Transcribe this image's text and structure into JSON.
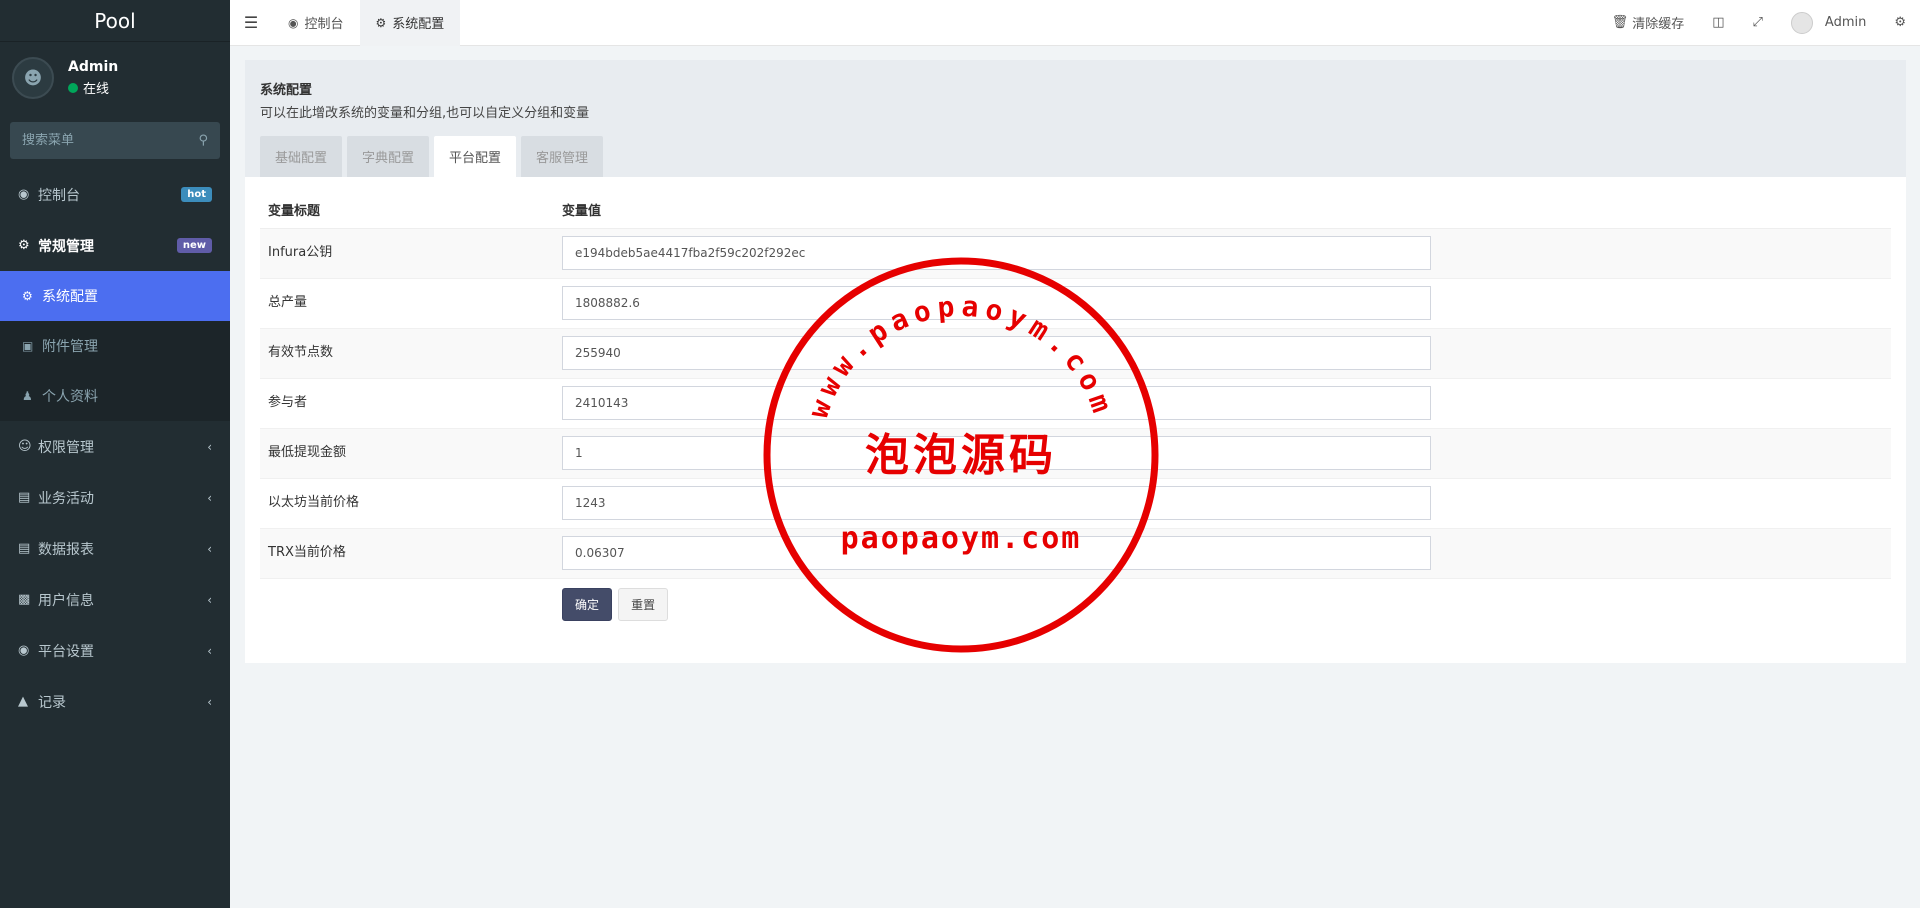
{
  "sidebar": {
    "logo": "Pool",
    "user": {
      "name": "Admin",
      "status": "在线"
    },
    "search_placeholder": "搜索菜单",
    "menu": [
      {
        "label": "控制台",
        "icon": "dashboard-icon",
        "badge": "hot"
      },
      {
        "label": "常规管理",
        "icon": "cogs-icon",
        "badge": "new"
      }
    ],
    "submenu": [
      {
        "label": "系统配置",
        "icon": "gear-icon",
        "active": true
      },
      {
        "label": "附件管理",
        "icon": "file-image-icon"
      },
      {
        "label": "个人资料",
        "icon": "user-icon"
      }
    ],
    "more_menu": [
      {
        "label": "权限管理",
        "icon": "group-icon"
      },
      {
        "label": "业务活动",
        "icon": "money-icon"
      },
      {
        "label": "数据报表",
        "icon": "file-text-icon"
      },
      {
        "label": "用户信息",
        "icon": "address-book-icon"
      },
      {
        "label": "平台设置",
        "icon": "dot-circle-icon"
      },
      {
        "label": "记录",
        "icon": "area-chart-icon"
      }
    ]
  },
  "topbar": {
    "tabs": [
      {
        "label": "控制台",
        "icon": "dashboard-icon"
      },
      {
        "label": "系统配置",
        "icon": "gear-icon",
        "active": true
      }
    ],
    "clear_cache": "清除缓存",
    "admin": "Admin"
  },
  "panel": {
    "title": "系统配置",
    "desc": "可以在此增改系统的变量和分组,也可以自定义分组和变量",
    "tabs": [
      "基础配置",
      "字典配置",
      "平台配置",
      "客服管理"
    ],
    "active_tab": 2
  },
  "table": {
    "headers": [
      "变量标题",
      "变量值"
    ],
    "rows": [
      {
        "label": "Infura公钥",
        "value": "e194bdeb5ae4417fba2f59c202f292ec"
      },
      {
        "label": "总产量",
        "value": "1808882.6"
      },
      {
        "label": "有效节点数",
        "value": "255940"
      },
      {
        "label": "参与者",
        "value": "2410143"
      },
      {
        "label": "最低提现金额",
        "value": "1"
      },
      {
        "label": "以太坊当前价格",
        "value": "1243"
      },
      {
        "label": "TRX当前价格",
        "value": "0.06307"
      }
    ]
  },
  "buttons": {
    "confirm": "确定",
    "reset": "重置"
  },
  "watermark": {
    "arc_text": "www.paopaoym.com",
    "center_text": "泡泡源码",
    "bottom_text": "paopaoym.com",
    "color": "#e60000"
  },
  "colors": {
    "sidebar_bg": "#222d32",
    "active_item": "#4c6ef0",
    "primary_button": "#444c69"
  }
}
